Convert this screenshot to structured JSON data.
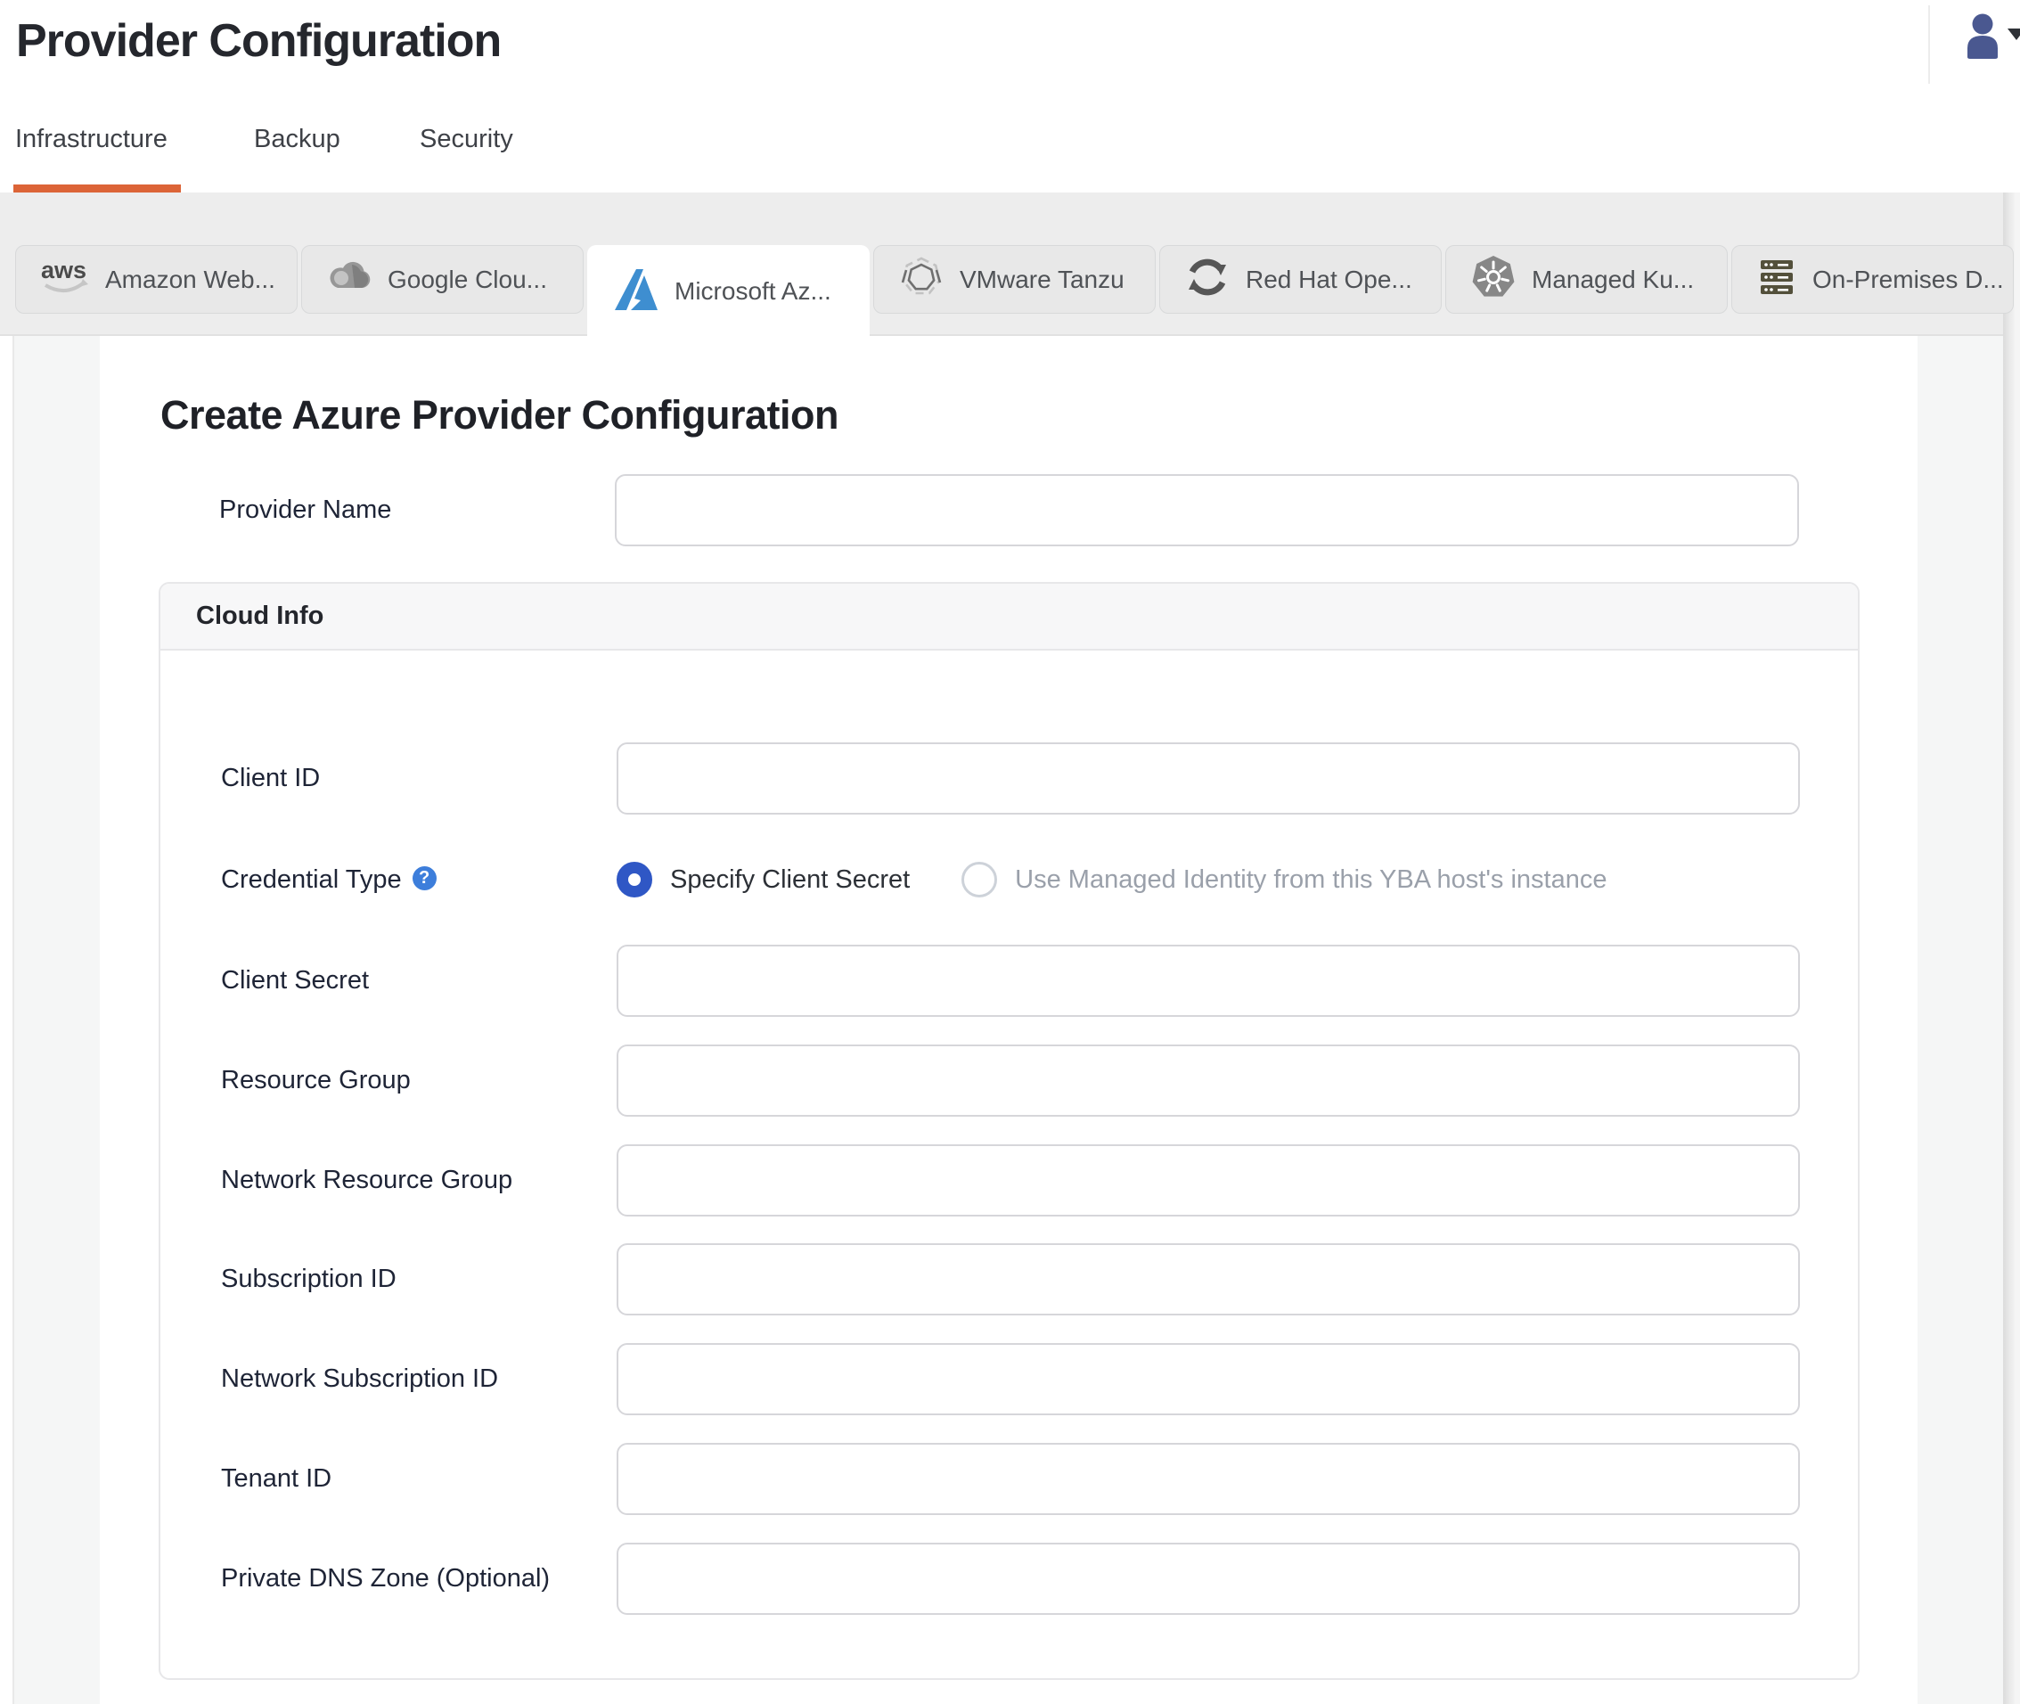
{
  "header": {
    "title": "Provider Configuration",
    "user_menu": {
      "icon": "user-icon",
      "caret_icon": "chevron-down-icon"
    }
  },
  "nav_tabs": {
    "items": [
      {
        "label": "Infrastructure",
        "active": true
      },
      {
        "label": "Backup",
        "active": false
      },
      {
        "label": "Security",
        "active": false
      }
    ],
    "active_underline_color": "#DC6437"
  },
  "provider_tabs": {
    "items": [
      {
        "label": "Amazon Web...",
        "icon": "aws-icon",
        "active": false
      },
      {
        "label": "Google Clou...",
        "icon": "google-cloud-icon",
        "active": false
      },
      {
        "label": "Microsoft Az...",
        "icon": "azure-icon",
        "active": true
      },
      {
        "label": "VMware Tanzu",
        "icon": "vmware-tanzu-icon",
        "active": false
      },
      {
        "label": "Red Hat Ope...",
        "icon": "openshift-icon",
        "active": false
      },
      {
        "label": "Managed Ku...",
        "icon": "kubernetes-icon",
        "active": false
      },
      {
        "label": "On-Premises D...",
        "icon": "onprem-server-icon",
        "active": false
      }
    ]
  },
  "form": {
    "heading": "Create Azure Provider Configuration",
    "provider_name": {
      "label": "Provider Name",
      "value": ""
    },
    "cloud_info": {
      "title": "Cloud Info",
      "credential_type": {
        "label": "Credential Type",
        "help_icon": "question-circle-icon",
        "help_glyph": "?",
        "options": [
          {
            "label": "Specify Client Secret",
            "selected": true,
            "disabled": false
          },
          {
            "label": "Use Managed Identity from this YBA host's instance",
            "selected": false,
            "disabled": true
          }
        ]
      },
      "fields": [
        {
          "label": "Client ID",
          "value": ""
        },
        {
          "label": "Client Secret",
          "value": ""
        },
        {
          "label": "Resource Group",
          "value": ""
        },
        {
          "label": "Network Resource Group",
          "value": ""
        },
        {
          "label": "Subscription ID",
          "value": ""
        },
        {
          "label": "Network Subscription ID",
          "value": ""
        },
        {
          "label": "Tenant ID",
          "value": ""
        },
        {
          "label": "Private DNS Zone (Optional)",
          "value": ""
        }
      ]
    }
  },
  "colors": {
    "accent_orange": "#DC6437",
    "radio_blue": "#2F57C5",
    "help_blue": "#3D7EDB",
    "azure_blue": "#3E8ED0",
    "avatar_indigo": "#4A5890"
  }
}
